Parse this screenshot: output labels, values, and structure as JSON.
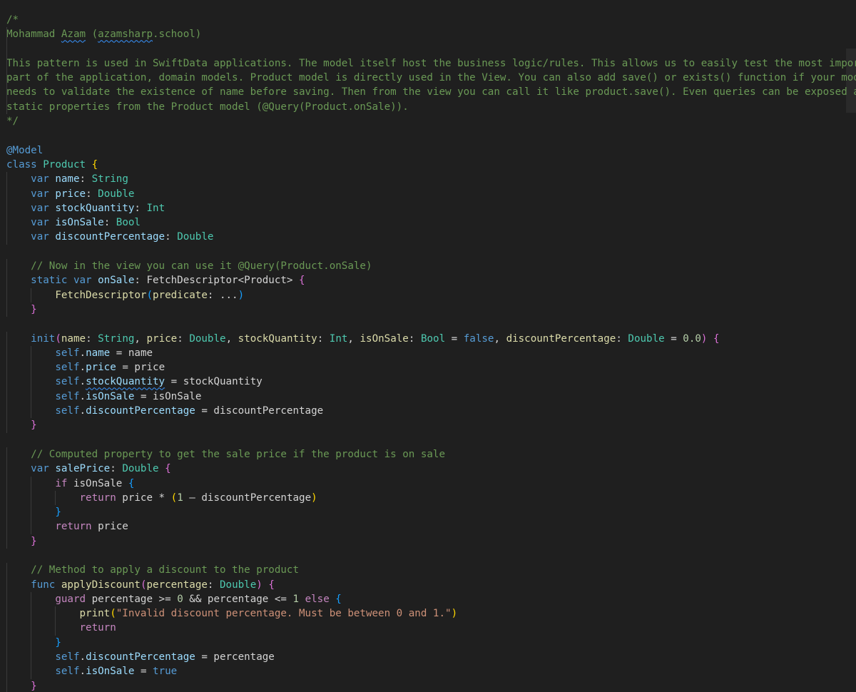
{
  "editor": {
    "language": "swift",
    "lines": [
      [
        {
          "t": "/*",
          "c": "comment"
        }
      ],
      [
        {
          "t": "Mohammad ",
          "c": "comment"
        },
        {
          "t": "Azam",
          "c": "comment squiggle"
        },
        {
          "t": " (",
          "c": "comment"
        },
        {
          "t": "azamsharp",
          "c": "comment squiggle"
        },
        {
          "t": ".school)",
          "c": "comment"
        }
      ],
      [
        {
          "t": "",
          "c": "comment"
        }
      ],
      [
        {
          "t": "This pattern is used in SwiftData applications. The model itself host the business logic/rules. This allows us to easily test the most important",
          "c": "comment"
        }
      ],
      [
        {
          "t": "part of the application, domain models. Product model is directly used in the View. You can also add save() or exists() function if your model",
          "c": "comment"
        }
      ],
      [
        {
          "t": "needs to validate the existence of name before saving. Then from the view you can call it like product.save(). Even queries can be exposed as",
          "c": "comment"
        }
      ],
      [
        {
          "t": "static properties from the Product model (@Query(Product.onSale)).",
          "c": "comment"
        }
      ],
      [
        {
          "t": "*/",
          "c": "comment"
        }
      ],
      [],
      [
        {
          "t": "@Model",
          "c": "attr"
        }
      ],
      [
        {
          "t": "class ",
          "c": "kw"
        },
        {
          "t": "Product ",
          "c": "type"
        },
        {
          "t": "{",
          "c": "br1"
        }
      ],
      [
        {
          "t": "    "
        },
        {
          "t": "var ",
          "c": "kw"
        },
        {
          "t": "name",
          "c": "var"
        },
        {
          "t": ": "
        },
        {
          "t": "String",
          "c": "type"
        }
      ],
      [
        {
          "t": "    "
        },
        {
          "t": "var ",
          "c": "kw"
        },
        {
          "t": "price",
          "c": "var"
        },
        {
          "t": ": "
        },
        {
          "t": "Double",
          "c": "type"
        }
      ],
      [
        {
          "t": "    "
        },
        {
          "t": "var ",
          "c": "kw"
        },
        {
          "t": "stockQuantity",
          "c": "var"
        },
        {
          "t": ": "
        },
        {
          "t": "Int",
          "c": "type"
        }
      ],
      [
        {
          "t": "    "
        },
        {
          "t": "var ",
          "c": "kw"
        },
        {
          "t": "isOnSale",
          "c": "var"
        },
        {
          "t": ": "
        },
        {
          "t": "Bool",
          "c": "type"
        }
      ],
      [
        {
          "t": "    "
        },
        {
          "t": "var ",
          "c": "kw"
        },
        {
          "t": "discountPercentage",
          "c": "var"
        },
        {
          "t": ": "
        },
        {
          "t": "Double",
          "c": "type"
        }
      ],
      [],
      [
        {
          "t": "    "
        },
        {
          "t": "// Now in the view you can use it @Query(Product.onSale)",
          "c": "comment"
        }
      ],
      [
        {
          "t": "    "
        },
        {
          "t": "static ",
          "c": "kw"
        },
        {
          "t": "var ",
          "c": "kw"
        },
        {
          "t": "onSale",
          "c": "var"
        },
        {
          "t": ": FetchDescriptor<Product> "
        },
        {
          "t": "{",
          "c": "br2"
        }
      ],
      [
        {
          "t": "        "
        },
        {
          "t": "FetchDescriptor",
          "c": "func"
        },
        {
          "t": "(",
          "c": "br3"
        },
        {
          "t": "predicate",
          "c": "func"
        },
        {
          "t": ": ..."
        },
        {
          "t": ")",
          "c": "br3"
        }
      ],
      [
        {
          "t": "    "
        },
        {
          "t": "}",
          "c": "br2"
        }
      ],
      [],
      [
        {
          "t": "    "
        },
        {
          "t": "init",
          "c": "kw"
        },
        {
          "t": "(",
          "c": "br2"
        },
        {
          "t": "name",
          "c": "func"
        },
        {
          "t": ": "
        },
        {
          "t": "String",
          "c": "type"
        },
        {
          "t": ", "
        },
        {
          "t": "price",
          "c": "func"
        },
        {
          "t": ": "
        },
        {
          "t": "Double",
          "c": "type"
        },
        {
          "t": ", "
        },
        {
          "t": "stockQuantity",
          "c": "func"
        },
        {
          "t": ": "
        },
        {
          "t": "Int",
          "c": "type"
        },
        {
          "t": ", "
        },
        {
          "t": "isOnSale",
          "c": "func"
        },
        {
          "t": ": "
        },
        {
          "t": "Bool",
          "c": "type"
        },
        {
          "t": " = "
        },
        {
          "t": "false",
          "c": "kw"
        },
        {
          "t": ", "
        },
        {
          "t": "discountPercentage",
          "c": "func"
        },
        {
          "t": ": "
        },
        {
          "t": "Double",
          "c": "type"
        },
        {
          "t": " = "
        },
        {
          "t": "0.0",
          "c": "num"
        },
        {
          "t": ")",
          "c": "br2"
        },
        {
          "t": " "
        },
        {
          "t": "{",
          "c": "br2"
        }
      ],
      [
        {
          "t": "        "
        },
        {
          "t": "self",
          "c": "kw"
        },
        {
          "t": "."
        },
        {
          "t": "name",
          "c": "var"
        },
        {
          "t": " = name"
        }
      ],
      [
        {
          "t": "        "
        },
        {
          "t": "self",
          "c": "kw"
        },
        {
          "t": "."
        },
        {
          "t": "price",
          "c": "var"
        },
        {
          "t": " = price"
        }
      ],
      [
        {
          "t": "        "
        },
        {
          "t": "self",
          "c": "kw"
        },
        {
          "t": "."
        },
        {
          "t": "stockQuantity",
          "c": "var squiggle"
        },
        {
          "t": " = stockQuantity"
        }
      ],
      [
        {
          "t": "        "
        },
        {
          "t": "self",
          "c": "kw"
        },
        {
          "t": "."
        },
        {
          "t": "isOnSale",
          "c": "var"
        },
        {
          "t": " = isOnSale"
        }
      ],
      [
        {
          "t": "        "
        },
        {
          "t": "self",
          "c": "kw"
        },
        {
          "t": "."
        },
        {
          "t": "discountPercentage",
          "c": "var"
        },
        {
          "t": " = discountPercentage"
        }
      ],
      [
        {
          "t": "    "
        },
        {
          "t": "}",
          "c": "br2"
        }
      ],
      [],
      [
        {
          "t": "    "
        },
        {
          "t": "// Computed property to get the sale price if the product is on sale",
          "c": "comment"
        }
      ],
      [
        {
          "t": "    "
        },
        {
          "t": "var ",
          "c": "kw"
        },
        {
          "t": "salePrice",
          "c": "var"
        },
        {
          "t": ": "
        },
        {
          "t": "Double",
          "c": "type"
        },
        {
          "t": " "
        },
        {
          "t": "{",
          "c": "br2"
        }
      ],
      [
        {
          "t": "        "
        },
        {
          "t": "if ",
          "c": "ctrl"
        },
        {
          "t": "isOnSale "
        },
        {
          "t": "{",
          "c": "br3"
        }
      ],
      [
        {
          "t": "            "
        },
        {
          "t": "return ",
          "c": "ctrl"
        },
        {
          "t": "price * "
        },
        {
          "t": "(",
          "c": "br1"
        },
        {
          "t": "1",
          "c": "num"
        },
        {
          "t": " – discountPercentage"
        },
        {
          "t": ")",
          "c": "br1"
        }
      ],
      [
        {
          "t": "        "
        },
        {
          "t": "}",
          "c": "br3"
        }
      ],
      [
        {
          "t": "        "
        },
        {
          "t": "return ",
          "c": "ctrl"
        },
        {
          "t": "price"
        }
      ],
      [
        {
          "t": "    "
        },
        {
          "t": "}",
          "c": "br2"
        }
      ],
      [],
      [
        {
          "t": "    "
        },
        {
          "t": "// Method to apply a discount to the product",
          "c": "comment"
        }
      ],
      [
        {
          "t": "    "
        },
        {
          "t": "func ",
          "c": "kw"
        },
        {
          "t": "applyDiscount",
          "c": "func"
        },
        {
          "t": "(",
          "c": "br2"
        },
        {
          "t": "percentage",
          "c": "func"
        },
        {
          "t": ": "
        },
        {
          "t": "Double",
          "c": "type"
        },
        {
          "t": ")",
          "c": "br2"
        },
        {
          "t": " "
        },
        {
          "t": "{",
          "c": "br2"
        }
      ],
      [
        {
          "t": "        "
        },
        {
          "t": "guard ",
          "c": "ctrl"
        },
        {
          "t": "percentage >= "
        },
        {
          "t": "0",
          "c": "num"
        },
        {
          "t": " && percentage <= "
        },
        {
          "t": "1",
          "c": "num"
        },
        {
          "t": " "
        },
        {
          "t": "else ",
          "c": "ctrl"
        },
        {
          "t": "{",
          "c": "br3"
        }
      ],
      [
        {
          "t": "            "
        },
        {
          "t": "print",
          "c": "func"
        },
        {
          "t": "(",
          "c": "br1"
        },
        {
          "t": "\"Invalid discount percentage. Must be between 0 and 1.\"",
          "c": "str"
        },
        {
          "t": ")",
          "c": "br1"
        }
      ],
      [
        {
          "t": "            "
        },
        {
          "t": "return",
          "c": "ctrl"
        }
      ],
      [
        {
          "t": "        "
        },
        {
          "t": "}",
          "c": "br3"
        }
      ],
      [
        {
          "t": "        "
        },
        {
          "t": "self",
          "c": "kw"
        },
        {
          "t": "."
        },
        {
          "t": "discountPercentage",
          "c": "var"
        },
        {
          "t": " = percentage"
        }
      ],
      [
        {
          "t": "        "
        },
        {
          "t": "self",
          "c": "kw"
        },
        {
          "t": "."
        },
        {
          "t": "isOnSale",
          "c": "var"
        },
        {
          "t": " = "
        },
        {
          "t": "true",
          "c": "kw"
        }
      ],
      [
        {
          "t": "    "
        },
        {
          "t": "}",
          "c": "br2"
        }
      ]
    ]
  }
}
